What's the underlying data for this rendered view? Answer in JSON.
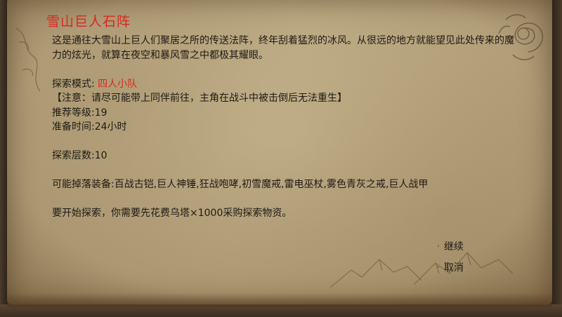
{
  "quest": {
    "title": "雪山巨人石阵",
    "description": "这是通往大雪山上巨人们聚居之所的传送法阵，终年刮着猛烈的冰风。从很远的地方就能望见此处传来的魔力的炫光，就算在夜空和暴风雪之中都极其耀眼。",
    "mode_label": "探索模式: ",
    "mode_value": "四人小队",
    "notice": "【注意：请尽可能带上同伴前往，主角在战斗中被击倒后无法重生】",
    "recommended_level": "推荐等级:19",
    "prep_time": "准备时间:24小时",
    "floors": "探索层数:10",
    "drops": "可能掉落装备:百战古铠,巨人神锤,狂战咆哮,初雪魔戒,雷电巫杖,雾色青灰之戒,巨人战甲",
    "cost": "要开始探索，你需要先花费乌塔×1000采购探索物资。"
  },
  "options": {
    "bullet": "·",
    "continue": "继续",
    "cancel": "取消"
  },
  "colors": {
    "title": "#d8281f",
    "text": "#1e1a14",
    "parchment": "#c2b18a"
  }
}
